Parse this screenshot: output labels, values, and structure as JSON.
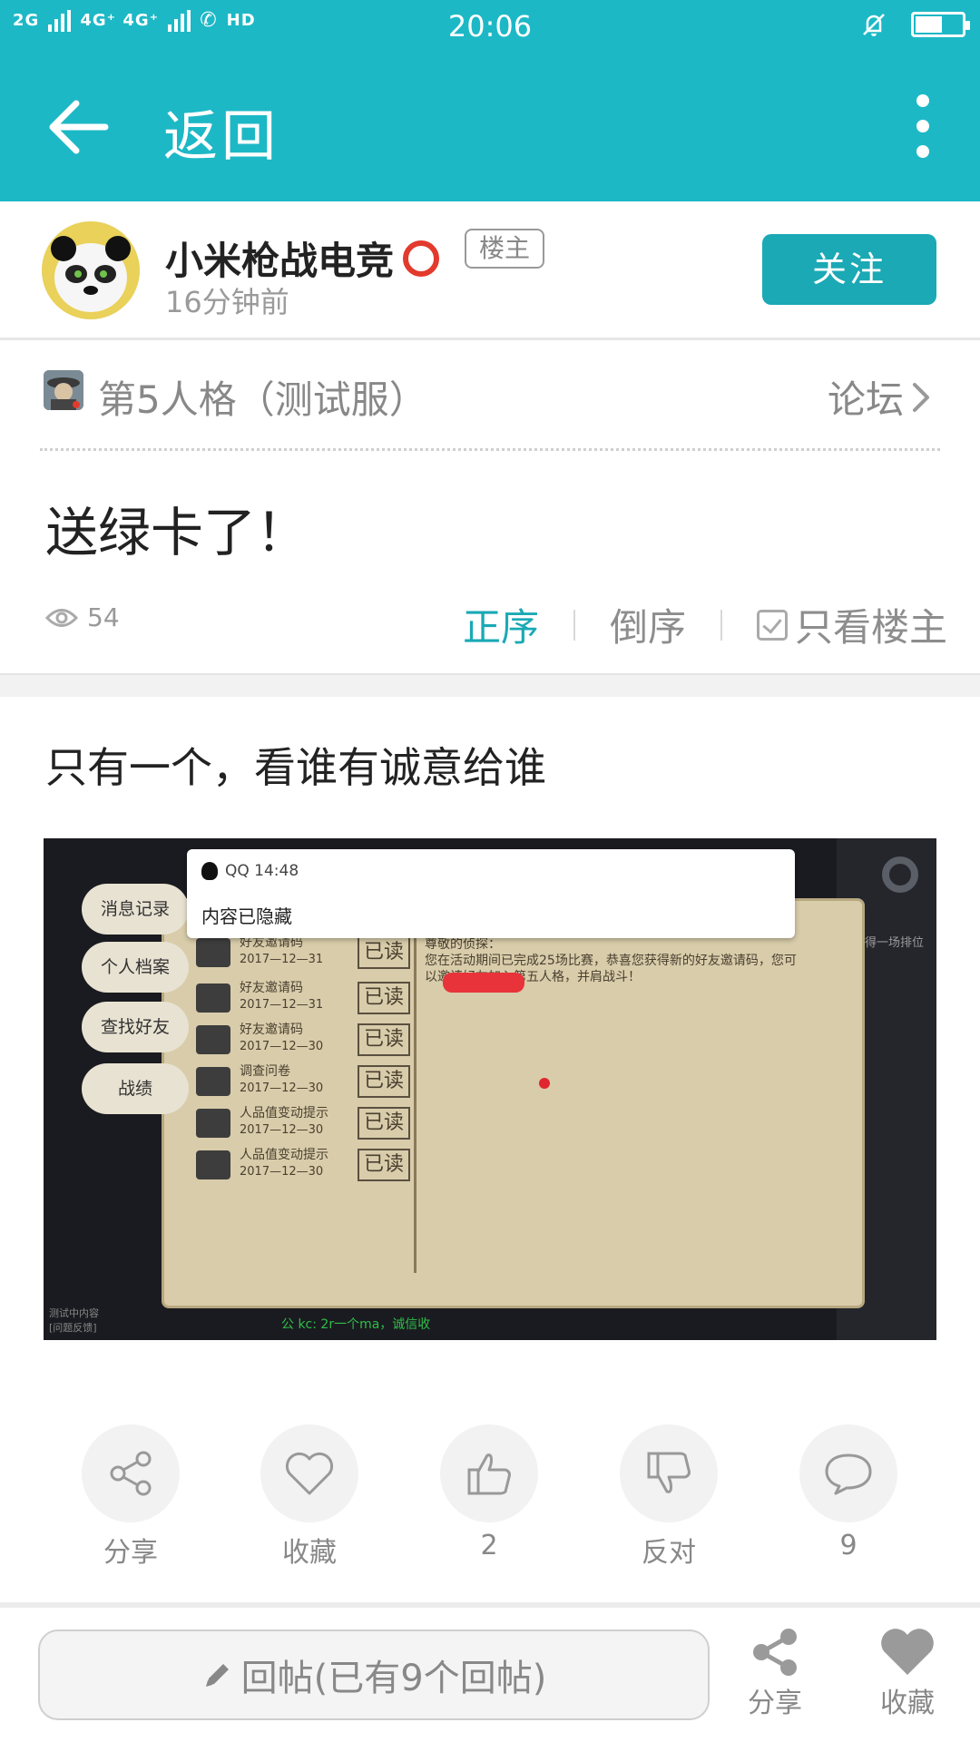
{
  "status_bar": {
    "network": "2G",
    "network2": "4G⁺ 4G⁺",
    "hd": "HD",
    "time": "20:06",
    "battery_level": 0.55
  },
  "app_bar": {
    "back_label": "返回",
    "back_icon": "arrow-left-icon",
    "more_icon": "more-vertical-icon"
  },
  "author": {
    "name": "小米枪战电竞",
    "badge": "楼主",
    "time_ago": "16分钟前",
    "follow_label": "关注"
  },
  "forum": {
    "name": "第5人格（测试服）",
    "link_label": "论坛"
  },
  "post": {
    "title": "送绿卡了！",
    "views": "54",
    "body": "只有一个，看谁有诚意给谁"
  },
  "sort": {
    "asc": "正序",
    "desc": "倒序",
    "only_op": "只看楼主"
  },
  "image": {
    "notification": {
      "app_time": "QQ 14:48",
      "message": "内容已隐藏"
    },
    "side_tabs": [
      "消息记录",
      "个人档案",
      "查找好友",
      "战绩"
    ],
    "messages": [
      {
        "title": "好友邀请码",
        "date": "2017—12—31",
        "stamp": "已读"
      },
      {
        "title": "好友邀请码",
        "date": "2017—12—31",
        "stamp": "已读"
      },
      {
        "title": "好友邀请码",
        "date": "2017—12—30",
        "stamp": "已读"
      },
      {
        "title": "调查问卷",
        "date": "2017—12—30",
        "stamp": "已读"
      },
      {
        "title": "人品值变动提示",
        "date": "2017—12—30",
        "stamp": "已读"
      },
      {
        "title": "人品值变动提示",
        "date": "2017—12—30",
        "stamp": "已读"
      }
    ],
    "letter_greeting": "尊敬的侦探：",
    "letter_body": "您在活动期间已完成25场比赛，恭喜您获得新的好友邀请码，您可以邀请好友加入第五人格，并肩战斗！",
    "footer_text": "测试中内容\n[问题反馈]",
    "chat_text": "公 kc: 2r一个ma，诚信收",
    "rank_text": "得一场排位"
  },
  "actions": [
    {
      "icon": "share-icon",
      "label": "分享"
    },
    {
      "icon": "heart-icon",
      "label": "收藏"
    },
    {
      "icon": "thumbs-up-icon",
      "label": "2"
    },
    {
      "icon": "thumbs-down-icon",
      "label": "反对"
    },
    {
      "icon": "comment-icon",
      "label": "9"
    }
  ],
  "bottom_bar": {
    "reply_label": "回帖(已有9个回帖)",
    "share_label": "分享",
    "favorite_label": "收藏"
  },
  "colors": {
    "accent": "#1db8c6",
    "button": "#1aa9b5",
    "text_muted": "#888888",
    "redaction": "#e8333a"
  }
}
